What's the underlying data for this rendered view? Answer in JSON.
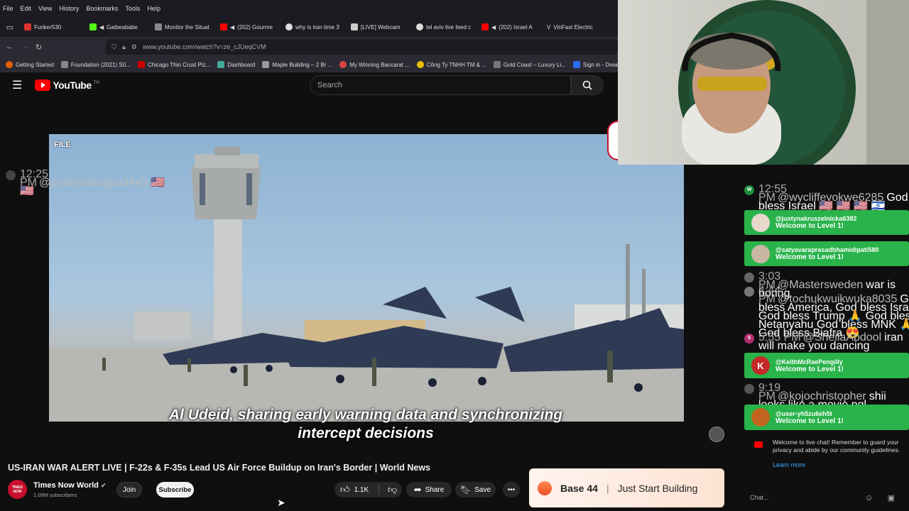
{
  "browser": {
    "menu": [
      "File",
      "Edit",
      "View",
      "History",
      "Bookmarks",
      "Tools",
      "Help"
    ],
    "tabs": [
      {
        "label": "Funker530",
        "color": "#d33"
      },
      {
        "label": "Gaibeababe",
        "color": "#53fc18"
      },
      {
        "label": "Monitor the Situat",
        "color": "#888"
      },
      {
        "label": "(202) Gourme",
        "color": "#f00"
      },
      {
        "label": "why is iran time 3",
        "color": "#ddd"
      },
      {
        "label": "[LIVE] Webcam",
        "color": "#ccc"
      },
      {
        "label": "tel aviv live feed c",
        "color": "#ddd"
      },
      {
        "label": "(202) Israel A",
        "color": "#f00"
      },
      {
        "label": "VinFast Electric",
        "color": "#fff"
      }
    ],
    "url": "www.youtube.com/watch?v=ze_cJUeqCVM",
    "bookmarks": [
      {
        "label": "Getting Started",
        "color": "#e66000"
      },
      {
        "label": "Foundation (2021) S0...",
        "color": "#888"
      },
      {
        "label": "Chicago Thin Crust Piz...",
        "color": "#c00"
      },
      {
        "label": "Dashboard",
        "color": "#4a9"
      },
      {
        "label": "Maple Building – 2 Br ...",
        "color": "#999"
      },
      {
        "label": "My Winning Baccarat ...",
        "color": "#d44"
      },
      {
        "label": "Công Ty TNHH TM & ...",
        "color": "#e6c000"
      },
      {
        "label": "Gold Coast – Luxury Li...",
        "color": "#777"
      },
      {
        "label": "Sign in - Drea",
        "color": "#2b6cf0"
      }
    ]
  },
  "youtube": {
    "logo_text": "YouTube",
    "logo_suffix": "TH",
    "search_placeholder": "Search"
  },
  "video": {
    "file_label": "FILE",
    "caption_line1": "Al Udeid, sharing early warning data and synchronizing",
    "caption_line2": "intercept decisions",
    "title": "US-IRAN WAR ALERT LIVE | F-22s & F-35s Lead US Air Force Buildup on Iran's Border | World News"
  },
  "owner": {
    "channel_name": "Times Now World",
    "avatar_text": "TIMES NOW",
    "subscribers": "1.09M subscribers",
    "join_label": "Join",
    "subscribe_label": "Subscribe"
  },
  "actions": {
    "likes": "1.1K",
    "share_label": "Share",
    "save_label": "Save"
  },
  "ad": {
    "brand": "Base 44",
    "separator": "|",
    "tagline": "Just Start Building"
  },
  "chat": {
    "messages": [
      {
        "time": "12:25 PM",
        "author": "@jontarioteague3443",
        "text": "🇺🇸 🇺🇸",
        "avatar_color": "#444",
        "avatar_letter": ""
      },
      {
        "time": "12:55 PM",
        "author": "@wycliffevokwe6285",
        "text": "God bless Israel 🇺🇸 🇺🇸 🇺🇸 🇮🇱",
        "avatar_color": "#1d8c3a",
        "avatar_letter": "W"
      },
      {
        "time": "3:03 PM",
        "author": "@Mastersweden",
        "text": "war is boring",
        "avatar_color": "#666",
        "avatar_letter": ""
      },
      {
        "time": "4:44 PM",
        "author": "@tochukwuikwuka8035",
        "text": "God bless America, God bless Israel, God bless Trump 🙏 God bless Netanyahu God bless MNK 🙏 God bless Biafra 😍",
        "avatar_color": "#777",
        "avatar_letter": ""
      },
      {
        "time": "5:55 PM",
        "author": "@SheilaAbdool",
        "text": "iran will make you dancing",
        "avatar_color": "#b0306e",
        "avatar_letter": "S"
      },
      {
        "time": "9:19 PM",
        "author": "@kojochristopher",
        "text": "shii looks like a movie ngl",
        "avatar_color": "#555",
        "avatar_letter": ""
      }
    ],
    "welcomes": [
      {
        "name": "@justynakruszelnicka6382",
        "text": "Welcome to Level 1!",
        "avatar_color": "#e8d8cc",
        "avatar_letter": ""
      },
      {
        "name": "@satyavaraprasadbhamidipati580",
        "text": "Welcome to Level 1!",
        "avatar_color": "#c9b7a4",
        "avatar_letter": ""
      },
      {
        "name": "@KeithMcRaePengilly",
        "text": "Welcome to Level 1!",
        "avatar_color": "#c62828",
        "avatar_letter": "K"
      },
      {
        "name": "@user-yh5zu6eh5t",
        "text": "Welcome to Level 1!",
        "avatar_color": "#c2651e",
        "avatar_letter": ""
      }
    ],
    "notice": "Welcome to live chat! Remember to guard your privacy and abide by our community guidelines.",
    "learn_more": "Learn more",
    "input_placeholder": "Chat..."
  }
}
